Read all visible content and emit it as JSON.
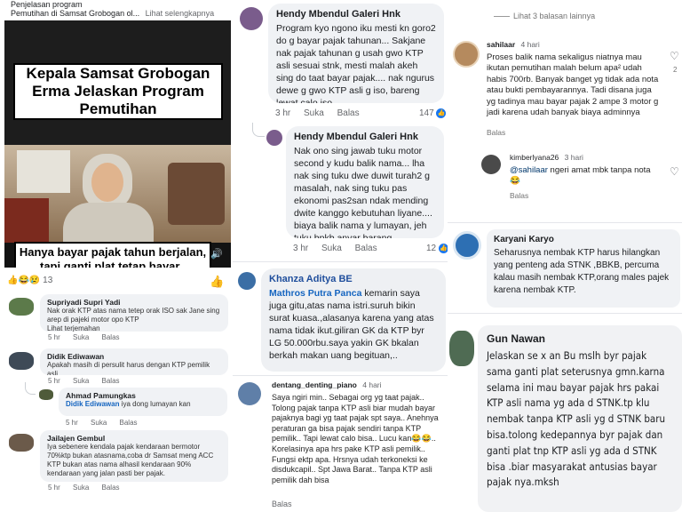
{
  "left": {
    "header_title": "Penjelasan program",
    "header_sub": "Pemutihan di Samsat Grobogan ol...",
    "see_more": "Lihat selengkapnya",
    "video_title": "Kepala Samsat Grobogan Erma Jelaskan Program Pemutihan",
    "video_caption": "Hanya bayar pajak tahun berjalan, tapi ganti plat tetap bayar..",
    "reaction_count": "13",
    "comments": [
      {
        "name": "Supriyadi Supri Yadi",
        "text": "Nak orak KTP atas nama tetep orak ISO sak Jane sing arep di pajeki motor opo KTP",
        "extra": "Lihat terjemahan",
        "time": "5 hr",
        "like": "Suka",
        "reply": "Balas"
      },
      {
        "name": "Didik Ediwawan",
        "text": "Apakah masih di persulit harus dengan KTP pemilik asli,",
        "time": "5 hr",
        "like": "Suka",
        "reply": "Balas"
      },
      {
        "name": "Ahmad Pamungkas",
        "mention": "Didik Ediwawan",
        "text": " iya dong lumayan kan",
        "time": "5 hr",
        "like": "Suka",
        "reply": "Balas"
      },
      {
        "name": "Jailajen Gembul",
        "text": "Iya sebenere kendala pajak kendaraan bermotor 70%ktp bukan atasnama,coba dr Samsat meng ACC KTP bukan atas nama alhasil kendaraan 90% kendaraan yang jalan pasti ber pajak.",
        "time": "5 hr",
        "like": "Suka",
        "reply": "Balas"
      }
    ]
  },
  "mid": {
    "comments": [
      {
        "name": "Hendy Mbendul Galeri Hnk",
        "text": "Program kyo ngono iku mesti kn goro2 do g bayar pajak tahunan... Sakjane nak pajak tahunan g usah gwo KTP asli sesuai stnk, mesti malah akeh sing do taat bayar pajak.... nak ngurus dewe g gwo KTP asli g iso, bareng lewat calo iso...",
        "time": "3 hr",
        "like": "Suka",
        "reply": "Balas",
        "count": "147"
      },
      {
        "name": "Hendy Mbendul Galeri Hnk",
        "text": "Nak ono sing jawab tuku motor second y kudu balik nama... lha nak sing tuku dwe duwit turah2 g masalah, nak sing tuku pas ekonomi pas2san ndak mending dwite kanggo kebutuhan liyane.... biaya balik nama y lumayan, jeh tuku bpkb anyar barang...",
        "time": "3 hr",
        "like": "Suka",
        "reply": "Balas",
        "count": "12"
      },
      {
        "name": "Khanza Aditya BE",
        "mention": "Mathros Putra Panca",
        "text": " kemarin saya juga gitu,atas nama istri.suruh bikin surat kuasa.,alasanya karena yang atas nama tidak ikut.giliran GK da KTP byr LG 50.000rbu.saya yakin GK bkalan berkah makan uang begituan,.."
      },
      {
        "name": "dentang_denting_piano",
        "time": "4 hari",
        "text": "Saya ngiri min.. Sebagai org yg taat pajak.. Tolong pajak tanpa KTP asli biar mudah bayar pajaknya bagi yg taat pajak spt saya.. Anehnya peraturan ga bisa pajak sendiri tanpa KTP pemilik.. Tapi lewat calo bisa.. Lucu kan😂😂.. Korelasinya apa hrs pake KTP asli pemilik.. Fungsi ektp apa. Hrsnya udah terkoneksi ke disdukcapil.. Spt Jawa Barat.. Tanpa KTP asli pemilik dah bisa",
        "reply": "Balas"
      }
    ]
  },
  "right": {
    "see_replies": "Lihat 3 balasan lainnya",
    "comments": [
      {
        "name": "sahilaar",
        "time": "4 hari",
        "text": "Proses balik nama sekaligus niatnya mau ikutan pemutihan malah belum apa² udah habis 700rb. Banyak banget yg tidak ada nota atau bukti pembayarannya. Tadi disana juga yg tadinya mau bayar pajak 2 ampe 3 motor g jadi karena udah banyak biaya adminnya",
        "reply": "Balas",
        "likes": "2"
      },
      {
        "name": "kimberlyana26",
        "time": "3 hari",
        "mention": "@sahilaar",
        "text": " ngeri amat mbk tanpa nota 😂",
        "reply": "Balas"
      },
      {
        "name": "Karyani Karyo",
        "text": "Seharusnya nembak KTP harus hilangkan yang penteng ada STNK ,BBKB, percuma kalau masih nembak KTP,orang males pajek karena nembak KTP."
      },
      {
        "name": "Gun Nawan",
        "text": "Jelaskan se x an Bu mslh byr pajak sama ganti plat seterusnya gmn.karna selama ini mau bayar pajak hrs pakai KTP asli nama yg ada d STNK.tp klu nembak tanpa KTP asli yg d STNK baru bisa.tolong kedepannya byr pajak dan ganti plat tnp KTP asli yg ada d STNK bisa .biar masyarakat antusias bayar pajak nya.mksh"
      }
    ]
  }
}
